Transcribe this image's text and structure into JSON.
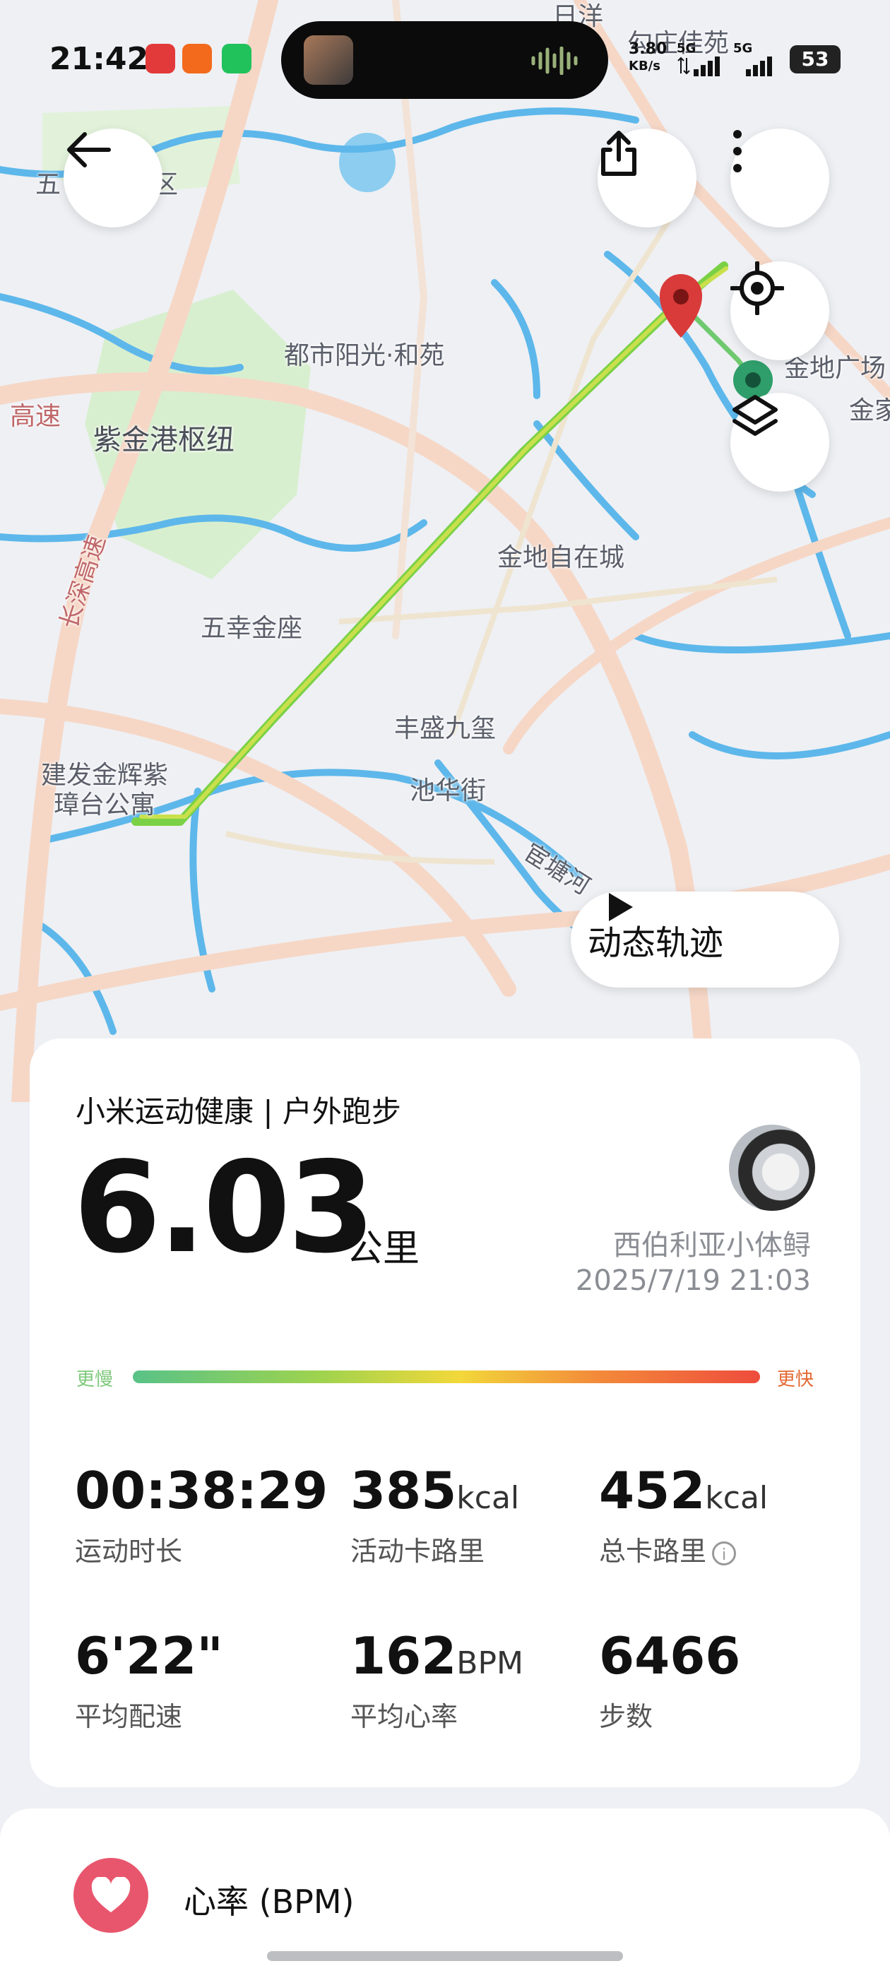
{
  "status_bar": {
    "time": "21:42",
    "net_speed_value": "3.80",
    "net_speed_unit": "KB/s",
    "sim1": "5G",
    "sim2": "5G",
    "battery": "53",
    "app_icons": [
      "netease-music-icon",
      "taobao-icon",
      "wechat-icon"
    ]
  },
  "map": {
    "labels": [
      "日洋",
      "勾庄佳苑",
      "五",
      "区",
      "都市阳光·和苑",
      "金地广场",
      "金家",
      "高速",
      "紫金港枢纽",
      "金地自在城",
      "长深高速",
      "五幸金座",
      "丰盛九玺",
      "建发金辉紫",
      "璋台公寓",
      "池华街",
      "宦塘河"
    ]
  },
  "toolbar": {
    "back": "back-arrow-icon",
    "share": "share-icon",
    "more": "more-icon",
    "locate": "locate-icon",
    "layers": "layers-icon"
  },
  "replay": {
    "label": "动态轨迹"
  },
  "summary": {
    "title": "小米运动健康 | 户外跑步",
    "distance": "6.03",
    "distance_unit": "公里",
    "username": "西伯利亚小体鲟",
    "datetime": "2025/7/19 21:03",
    "pace_slow": "更慢",
    "pace_fast": "更快",
    "stats": [
      {
        "value": "00:38:29",
        "unit": "",
        "label": "运动时长"
      },
      {
        "value": "385",
        "unit": "kcal",
        "label": "活动卡路里"
      },
      {
        "value": "452",
        "unit": "kcal",
        "label": "总卡路里"
      },
      {
        "value": "6'22\"",
        "unit": "",
        "label": "平均配速"
      },
      {
        "value": "162",
        "unit": "BPM",
        "label": "平均心率"
      },
      {
        "value": "6466",
        "unit": "",
        "label": "步数"
      }
    ]
  },
  "heart_rate": {
    "title": "心率 (BPM)"
  },
  "colors": {
    "route_green": "#7bd146",
    "start_marker": "#d93a3a",
    "end_marker": "#2f9e6a",
    "heart_accent": "#e8566d"
  }
}
